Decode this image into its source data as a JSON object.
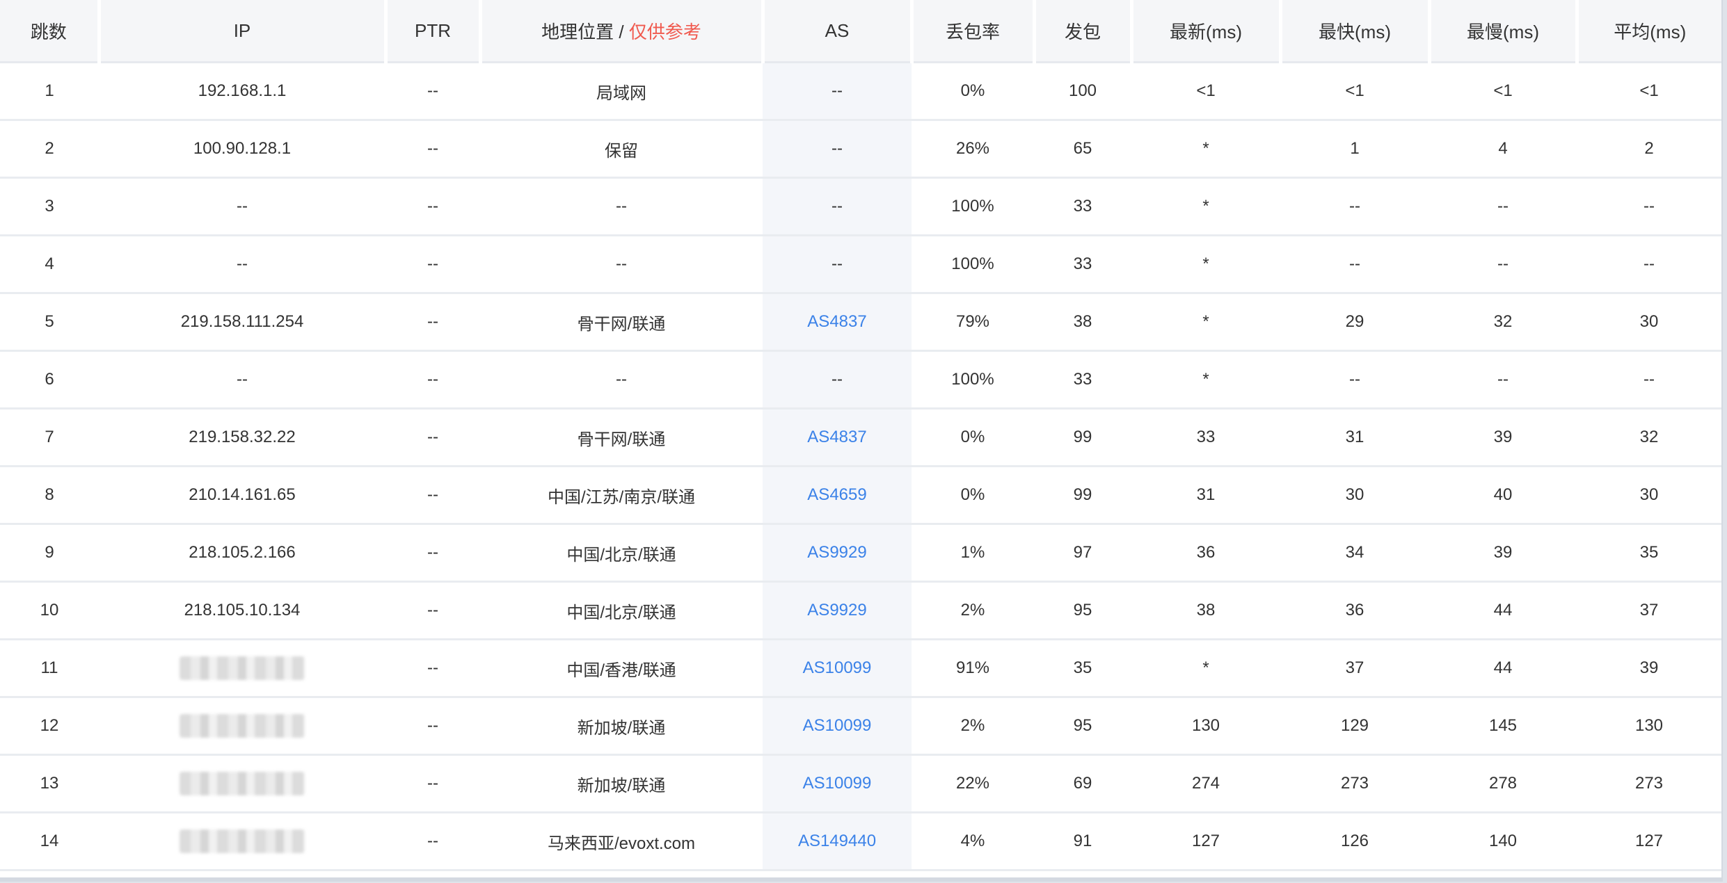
{
  "headers": {
    "hop": "跳数",
    "ip": "IP",
    "ptr": "PTR",
    "geo": "地理位置",
    "geo_sep": " / ",
    "geo_note": "仅供参考",
    "as": "AS",
    "loss": "丢包率",
    "sent": "发包",
    "last": "最新(ms)",
    "best": "最快(ms)",
    "worst": "最慢(ms)",
    "avg": "平均(ms)"
  },
  "colors": {
    "header_bg": "#f5f6f8",
    "note_red": "#f05a4f",
    "as_link_blue": "#3b82e8",
    "as_cell_bg": "#f4f6fa",
    "row_border": "#e9ecf0"
  },
  "rows": [
    {
      "hop": "1",
      "ip": "192.168.1.1",
      "ip_hidden": false,
      "ptr": "--",
      "geo": "局域网",
      "as": "--",
      "as_link": false,
      "loss": "0%",
      "sent": "100",
      "last": "<1",
      "best": "<1",
      "worst": "<1",
      "avg": "<1"
    },
    {
      "hop": "2",
      "ip": "100.90.128.1",
      "ip_hidden": false,
      "ptr": "--",
      "geo": "保留",
      "as": "--",
      "as_link": false,
      "loss": "26%",
      "sent": "65",
      "last": "*",
      "best": "1",
      "worst": "4",
      "avg": "2"
    },
    {
      "hop": "3",
      "ip": "--",
      "ip_hidden": false,
      "ptr": "--",
      "geo": "--",
      "as": "--",
      "as_link": false,
      "loss": "100%",
      "sent": "33",
      "last": "*",
      "best": "--",
      "worst": "--",
      "avg": "--"
    },
    {
      "hop": "4",
      "ip": "--",
      "ip_hidden": false,
      "ptr": "--",
      "geo": "--",
      "as": "--",
      "as_link": false,
      "loss": "100%",
      "sent": "33",
      "last": "*",
      "best": "--",
      "worst": "--",
      "avg": "--"
    },
    {
      "hop": "5",
      "ip": "219.158.111.254",
      "ip_hidden": false,
      "ptr": "--",
      "geo": "骨干网/联通",
      "as": "AS4837",
      "as_link": true,
      "loss": "79%",
      "sent": "38",
      "last": "*",
      "best": "29",
      "worst": "32",
      "avg": "30"
    },
    {
      "hop": "6",
      "ip": "--",
      "ip_hidden": false,
      "ptr": "--",
      "geo": "--",
      "as": "--",
      "as_link": false,
      "loss": "100%",
      "sent": "33",
      "last": "*",
      "best": "--",
      "worst": "--",
      "avg": "--"
    },
    {
      "hop": "7",
      "ip": "219.158.32.22",
      "ip_hidden": false,
      "ptr": "--",
      "geo": "骨干网/联通",
      "as": "AS4837",
      "as_link": true,
      "loss": "0%",
      "sent": "99",
      "last": "33",
      "best": "31",
      "worst": "39",
      "avg": "32"
    },
    {
      "hop": "8",
      "ip": "210.14.161.65",
      "ip_hidden": false,
      "ptr": "--",
      "geo": "中国/江苏/南京/联通",
      "as": "AS4659",
      "as_link": true,
      "loss": "0%",
      "sent": "99",
      "last": "31",
      "best": "30",
      "worst": "40",
      "avg": "30"
    },
    {
      "hop": "9",
      "ip": "218.105.2.166",
      "ip_hidden": false,
      "ptr": "--",
      "geo": "中国/北京/联通",
      "as": "AS9929",
      "as_link": true,
      "loss": "1%",
      "sent": "97",
      "last": "36",
      "best": "34",
      "worst": "39",
      "avg": "35"
    },
    {
      "hop": "10",
      "ip": "218.105.10.134",
      "ip_hidden": false,
      "ptr": "--",
      "geo": "中国/北京/联通",
      "as": "AS9929",
      "as_link": true,
      "loss": "2%",
      "sent": "95",
      "last": "38",
      "best": "36",
      "worst": "44",
      "avg": "37"
    },
    {
      "hop": "11",
      "ip": "",
      "ip_hidden": true,
      "ptr": "--",
      "geo": "中国/香港/联通",
      "as": "AS10099",
      "as_link": true,
      "loss": "91%",
      "sent": "35",
      "last": "*",
      "best": "37",
      "worst": "44",
      "avg": "39"
    },
    {
      "hop": "12",
      "ip": "",
      "ip_hidden": true,
      "ptr": "--",
      "geo": "新加坡/联通",
      "as": "AS10099",
      "as_link": true,
      "loss": "2%",
      "sent": "95",
      "last": "130",
      "best": "129",
      "worst": "145",
      "avg": "130"
    },
    {
      "hop": "13",
      "ip": "",
      "ip_hidden": true,
      "ptr": "--",
      "geo": "新加坡/联通",
      "as": "AS10099",
      "as_link": true,
      "loss": "22%",
      "sent": "69",
      "last": "274",
      "best": "273",
      "worst": "278",
      "avg": "273"
    },
    {
      "hop": "14",
      "ip": "",
      "ip_hidden": true,
      "ptr": "--",
      "geo": "马来西亚/evoxt.com",
      "as": "AS149440",
      "as_link": true,
      "loss": "4%",
      "sent": "91",
      "last": "127",
      "best": "126",
      "worst": "140",
      "avg": "127"
    }
  ]
}
